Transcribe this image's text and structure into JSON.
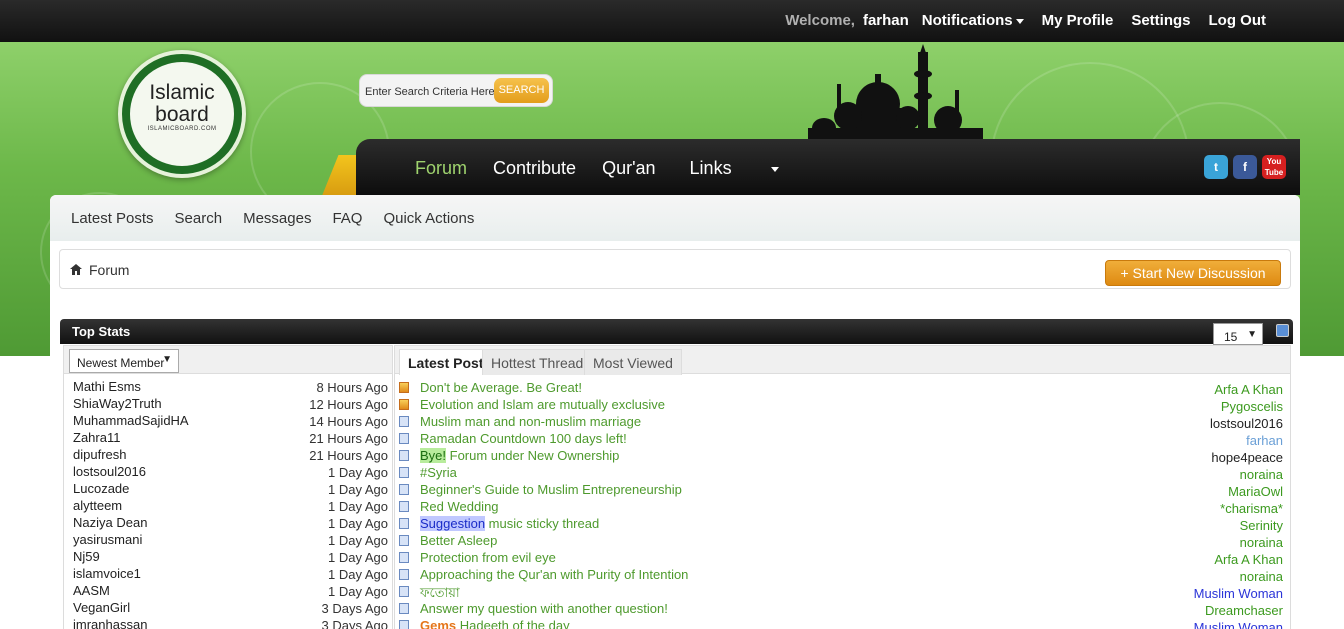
{
  "topbar": {
    "welcome": "Welcome,",
    "username": "farhan",
    "notifications": "Notifications",
    "my_profile": "My Profile",
    "settings": "Settings",
    "log_out": "Log Out"
  },
  "logo": {
    "line1": "Islamic",
    "line2": "board",
    "line3": "ISLAMICBOARD.COM"
  },
  "search": {
    "placeholder": "Enter Search Criteria Here",
    "button": "SEARCH"
  },
  "nav": {
    "forum": "Forum",
    "contribute": "Contribute",
    "quran": "Qur'an",
    "links": "Links"
  },
  "social": {
    "twitter": "t",
    "facebook": "f",
    "youtube": "You Tube"
  },
  "subnav": {
    "latest_posts": "Latest Posts",
    "search": "Search",
    "messages": "Messages",
    "faq": "FAQ",
    "quick_actions": "Quick Actions"
  },
  "breadcrumb": {
    "forum": "Forum"
  },
  "start_button": "+ Start New Discussion",
  "top_stats": {
    "title": "Top Stats",
    "count_select": "15",
    "member_select": "Newest Member",
    "tabs": [
      "Latest Post",
      "Hottest Thread",
      "Most Viewed"
    ],
    "members": [
      {
        "name": "Mathi Esms",
        "ago": "8 Hours Ago"
      },
      {
        "name": "ShiaWay2Truth",
        "ago": "12 Hours Ago"
      },
      {
        "name": "MuhammadSajidHA",
        "ago": "14 Hours Ago"
      },
      {
        "name": "Zahra11",
        "ago": "21 Hours Ago"
      },
      {
        "name": "dipufresh",
        "ago": "21 Hours Ago"
      },
      {
        "name": "lostsoul2016",
        "ago": "1 Day Ago"
      },
      {
        "name": "Lucozade",
        "ago": "1 Day Ago"
      },
      {
        "name": "alytteem",
        "ago": "1 Day Ago"
      },
      {
        "name": "Naziya Dean",
        "ago": "1 Day Ago"
      },
      {
        "name": "yasirusmani",
        "ago": "1 Day Ago"
      },
      {
        "name": "Nj59",
        "ago": "1 Day Ago"
      },
      {
        "name": "islamvoice1",
        "ago": "1 Day Ago"
      },
      {
        "name": "AASM",
        "ago": "1 Day Ago"
      },
      {
        "name": "VeganGirl",
        "ago": "3 Days Ago"
      },
      {
        "name": "imranhassan",
        "ago": "3 Days Ago"
      }
    ],
    "threads": [
      {
        "prefix": "",
        "title": "Don't be Average. Be Great!",
        "author": "Arfa A Khan",
        "author_color": "#3c9a1f",
        "hot": true
      },
      {
        "prefix": "",
        "title": "Evolution and Islam are mutually exclusive",
        "author": "Pygoscelis",
        "author_color": "#3c9a1f",
        "hot": true
      },
      {
        "prefix": "",
        "title": "Muslim man and non-muslim marriage",
        "author": "lostsoul2016",
        "author_color": "#222222",
        "hot": false
      },
      {
        "prefix": "",
        "title": "Ramadan Countdown 100 days left!",
        "author": "farhan",
        "author_color": "#6a9fd6",
        "hot": false
      },
      {
        "prefix": "Bye!",
        "title": " Forum under New Ownership",
        "author": "hope4peace",
        "author_color": "#222222",
        "hot": false,
        "prefix_style": "green"
      },
      {
        "prefix": "",
        "title": "#Syria",
        "author": "noraina",
        "author_color": "#3c9a1f",
        "hot": false
      },
      {
        "prefix": "",
        "title": "Beginner's Guide to Muslim Entrepreneurship",
        "author": "MariaOwl",
        "author_color": "#3c9a1f",
        "hot": false
      },
      {
        "prefix": "",
        "title": "Red Wedding",
        "author": "*charisma*",
        "author_color": "#3c9a1f",
        "hot": false
      },
      {
        "prefix": "Suggestion",
        "title": " music sticky thread",
        "author": "Serinity",
        "author_color": "#3c9a1f",
        "hot": false,
        "prefix_style": "blue"
      },
      {
        "prefix": "",
        "title": "Better Asleep",
        "author": "noraina",
        "author_color": "#3c9a1f",
        "hot": false
      },
      {
        "prefix": "",
        "title": "Protection from evil eye",
        "author": "Arfa A Khan",
        "author_color": "#3c9a1f",
        "hot": false
      },
      {
        "prefix": "",
        "title": "Approaching the Qur'an with Purity of Intention",
        "author": "noraina",
        "author_color": "#3c9a1f",
        "hot": false
      },
      {
        "prefix": "",
        "title": "ফতোয়া",
        "author": "Muslim Woman",
        "author_color": "#2a34d8",
        "hot": false
      },
      {
        "prefix": "",
        "title": "Answer my question with another question!",
        "author": "Dreamchaser",
        "author_color": "#3c9a1f",
        "hot": false
      },
      {
        "prefix": "Gems",
        "title": " Hadeeth of the day",
        "author": "Muslim Woman",
        "author_color": "#2a34d8",
        "hot": false,
        "prefix_style": "orange"
      }
    ]
  }
}
